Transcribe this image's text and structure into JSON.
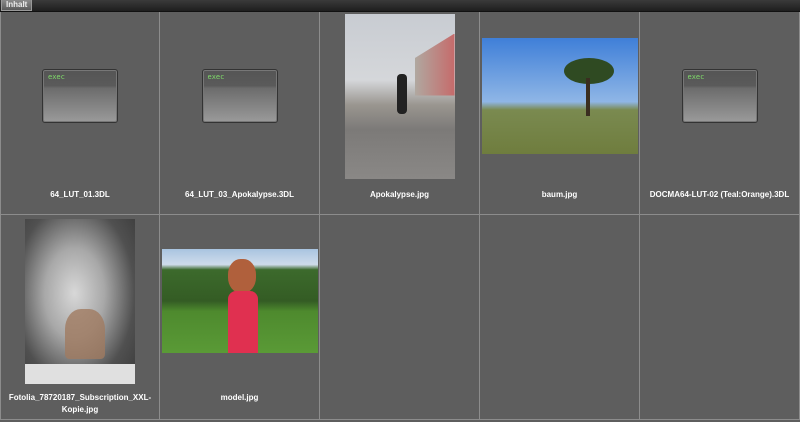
{
  "tab": {
    "label": "Inhalt"
  },
  "exec_label": "exec",
  "items": [
    {
      "name": "64_LUT_01.3DL",
      "type": "exec"
    },
    {
      "name": "64_LUT_03_Apokalypse.3DL",
      "type": "exec"
    },
    {
      "name": "Apokalypse.jpg",
      "type": "image"
    },
    {
      "name": "baum.jpg",
      "type": "image"
    },
    {
      "name": "DOCMA64-LUT-02 (Teal:Orange).3DL",
      "type": "exec"
    },
    {
      "name": "Fotolia_78720187_Subscription_XXL-Kopie.jpg",
      "type": "image"
    },
    {
      "name": "model.jpg",
      "type": "image"
    }
  ]
}
